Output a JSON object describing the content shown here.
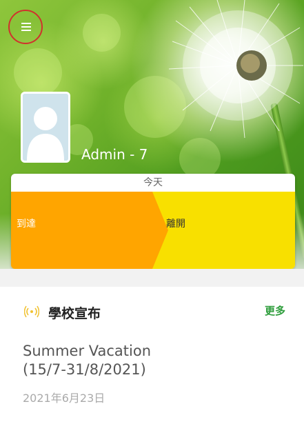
{
  "header": {
    "menu_icon": "hamburger-icon",
    "menu_highlight_color": "#d0312d"
  },
  "profile": {
    "name": "Admin - 7",
    "avatar_icon": "user-placeholder-icon"
  },
  "today": {
    "label": "今天",
    "arrive_label": "到達",
    "leave_label": "離開",
    "arrive_color": "#ffa500",
    "leave_color": "#f8e000"
  },
  "announcements": {
    "icon": "broadcast-icon",
    "icon_color": "#f1c232",
    "title": "學校宣布",
    "more_label": "更多",
    "more_color": "#2e9d3c",
    "items": [
      {
        "title_line1": "Summer Vacation",
        "title_line2": "(15/7-31/8/2021)",
        "date": "2021年6月23日"
      }
    ]
  }
}
